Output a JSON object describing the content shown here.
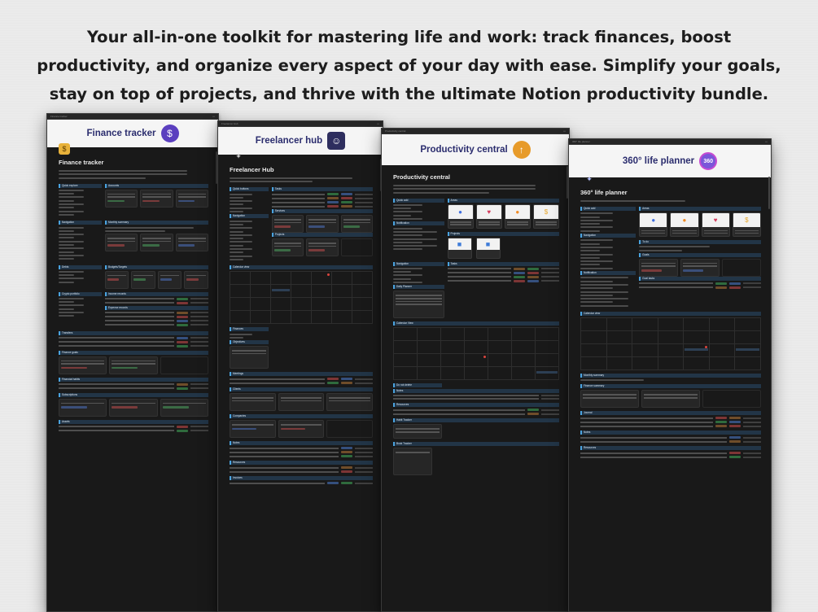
{
  "headline": {
    "line1": "Your all-in-one toolkit for mastering life and work: track finances, boost",
    "line2": "productivity, and organize every aspect of your day with ease. Simplify your goals,",
    "line3": "stay on top of projects, and thrive with the ultimate Notion productivity bundle."
  },
  "windows": [
    {
      "banner_title": "Finance tracker",
      "banner_icon": "dollar-coin-icon",
      "page_title": "Finance tracker",
      "sections": [
        "Quick explore",
        "Accounts",
        "Monthly summary",
        "Navigation",
        "Budgets/Targets",
        "Debts",
        "Income records",
        "Expense records",
        "Crypto portfolio",
        "Transfers",
        "Finance goals",
        "Financial habits",
        "Subscriptions",
        "Assets"
      ]
    },
    {
      "banner_title": "Freelancer hub",
      "banner_icon": "person-at-laptop-icon",
      "page_title": "Freelancer Hub",
      "sections": [
        "Quick buttons",
        "Tasks",
        "Navigation",
        "Services",
        "Projects",
        "Calendar view",
        "Finances",
        "Objectives",
        "Meetings",
        "Clients",
        "Companies",
        "Notes",
        "Resources",
        "Invoices"
      ]
    },
    {
      "banner_title": "Productivity central",
      "banner_icon": "rocket-arrow-icon",
      "page_title": "Productivity central",
      "sections": [
        "Quick add",
        "Areas",
        "Notification",
        "Projects",
        "Navigation",
        "Tasks",
        "Daily Planner",
        "Calendar View",
        "Do not delete",
        "Notes",
        "Resources",
        "Habit Tracker",
        "Book Tracker"
      ]
    },
    {
      "banner_title": "360° life planner",
      "banner_icon": "360-badge-icon",
      "banner_icon_text": "360",
      "page_title": "360° life planner",
      "sections": [
        "Quick add",
        "Areas",
        "Navigation",
        "To do",
        "Goals",
        "Notification",
        "Goal tasks",
        "Calendar view",
        "Monthly summary",
        "Finance summary",
        "Journal",
        "Notes",
        "Resources"
      ]
    }
  ]
}
